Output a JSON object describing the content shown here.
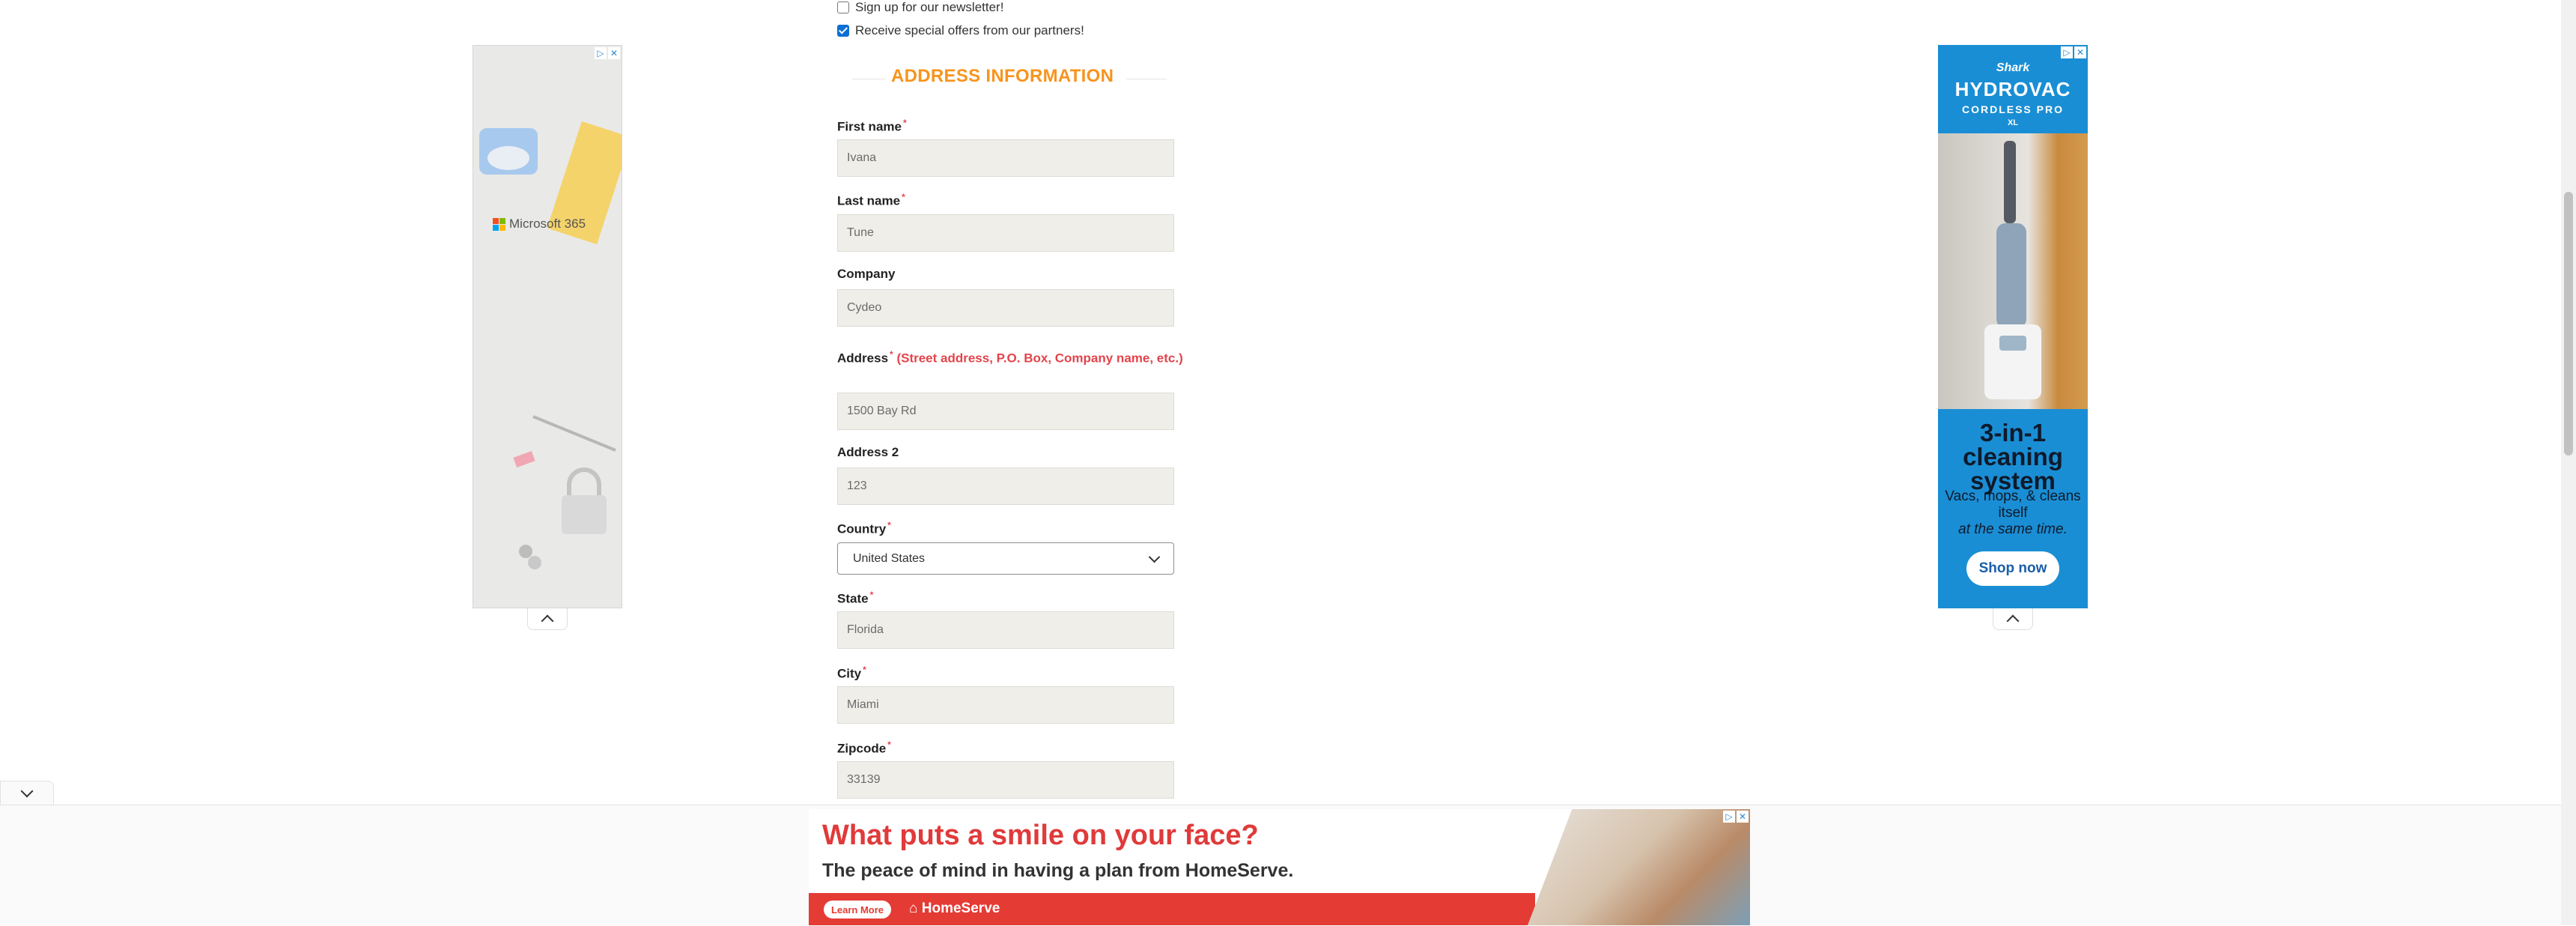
{
  "newsletter": {
    "signup_label": "Sign up for our newsletter!",
    "signup_checked": false,
    "offers_label": "Receive special offers from our partners!",
    "offers_checked": true
  },
  "section": {
    "title": "ADDRESS INFORMATION"
  },
  "form": {
    "first_name": {
      "label": "First name",
      "value": "Ivana"
    },
    "last_name": {
      "label": "Last name",
      "value": "Tune"
    },
    "company": {
      "label": "Company",
      "value": "Cydeo"
    },
    "address": {
      "label": "Address",
      "hint": "(Street address, P.O. Box, Company name, etc.)",
      "value": "1500 Bay Rd"
    },
    "address2": {
      "label": "Address 2",
      "value": "123"
    },
    "country": {
      "label": "Country",
      "value": "United States"
    },
    "state": {
      "label": "State",
      "value": "Florida"
    },
    "city": {
      "label": "City",
      "value": "Miami"
    },
    "zipcode": {
      "label": "Zipcode",
      "value": "33139"
    },
    "required_marker": "*"
  },
  "ads": {
    "left": {
      "brand": "Microsoft 365",
      "colors": [
        "#f25022",
        "#7fba00",
        "#00a4ef",
        "#ffb900"
      ]
    },
    "right": {
      "brand": "Shark",
      "product_line1": "HYDROVAC",
      "product_line2": "CORDLESS PRO",
      "product_line3": "XL",
      "headline": "3-in-1 cleaning system",
      "sub": "Vacs, mops, & cleans itself",
      "sub_italic": "at the same time.",
      "cta": "Shop now"
    },
    "bottom": {
      "headline": "What puts a smile on your face?",
      "subline": "The peace of mind in having a plan from HomeServe.",
      "cta": "Learn More",
      "brand": "HomeServe"
    },
    "control_icons": [
      "adchoices-icon",
      "close-icon"
    ]
  },
  "colors": {
    "accent": "#f7941d",
    "error": "#e4434b",
    "field_bg": "#efeee9",
    "checkbox": "#0b6fd3"
  }
}
